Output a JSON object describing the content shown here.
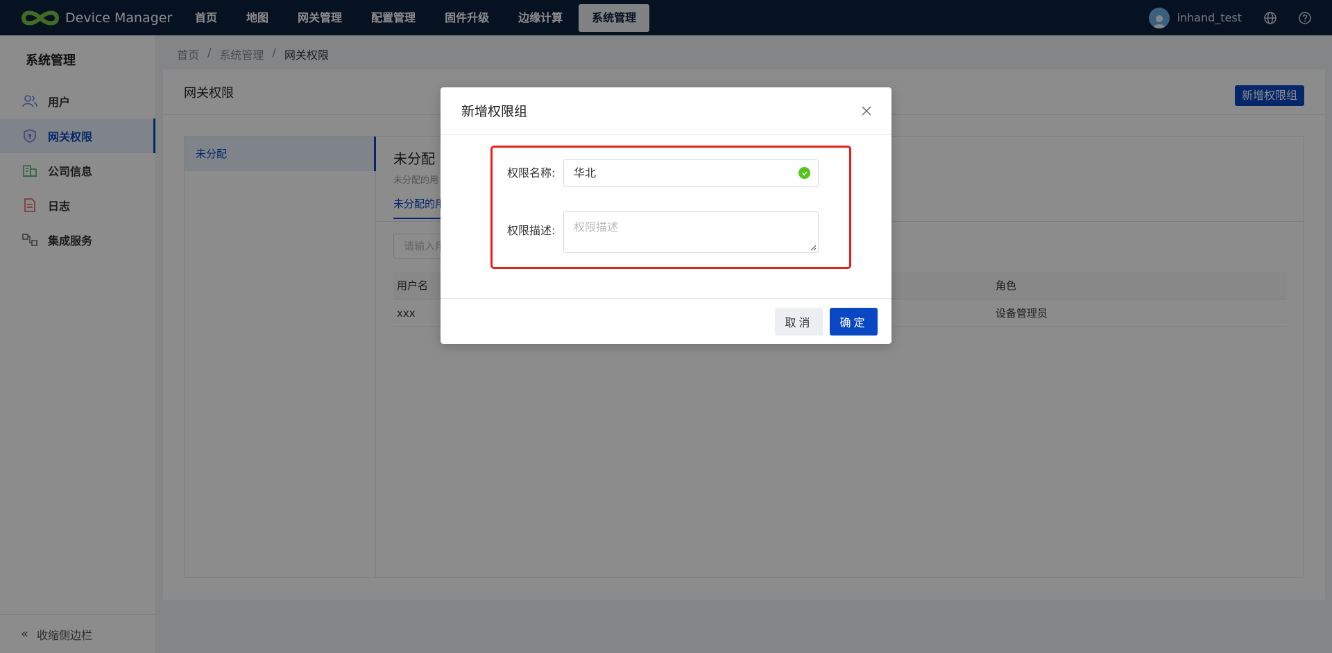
{
  "app": {
    "title": "Device Manager"
  },
  "nav": [
    {
      "label": "首页"
    },
    {
      "label": "地图"
    },
    {
      "label": "网关管理"
    },
    {
      "label": "配置管理"
    },
    {
      "label": "固件升级"
    },
    {
      "label": "边缘计算"
    },
    {
      "label": "系统管理",
      "active": true
    }
  ],
  "user": {
    "name": "inhand_test"
  },
  "sidebar": {
    "title": "系统管理",
    "items": [
      {
        "label": "用户",
        "icon": "users-icon"
      },
      {
        "label": "网关权限",
        "icon": "shield-icon",
        "active": true
      },
      {
        "label": "公司信息",
        "icon": "building-icon"
      },
      {
        "label": "日志",
        "icon": "document-icon"
      },
      {
        "label": "集成服务",
        "icon": "integration-icon"
      }
    ],
    "collapse_label": "收缩侧边栏"
  },
  "breadcrumb": [
    "首页",
    "系统管理",
    "网关权限"
  ],
  "page": {
    "title": "网关权限",
    "add_button": "新增权限组",
    "groups": [
      "未分配"
    ],
    "detail_title": "未分配",
    "detail_sub": "未分配的用",
    "tab": "未分配的用",
    "search_placeholder": "请输入用",
    "table": {
      "headers": [
        "用户名",
        "角色"
      ],
      "rows": [
        [
          "xxx",
          "设备管理员"
        ]
      ]
    }
  },
  "modal": {
    "title": "新增权限组",
    "name_label": "权限名称:",
    "name_value": "华北",
    "desc_label": "权限描述:",
    "desc_placeholder": "权限描述",
    "cancel": "取消",
    "ok": "确定"
  },
  "colors": {
    "primary": "#0a47c2",
    "topbar": "#0b1f3f",
    "highlight": "#e8201a",
    "success": "#52c41a"
  }
}
